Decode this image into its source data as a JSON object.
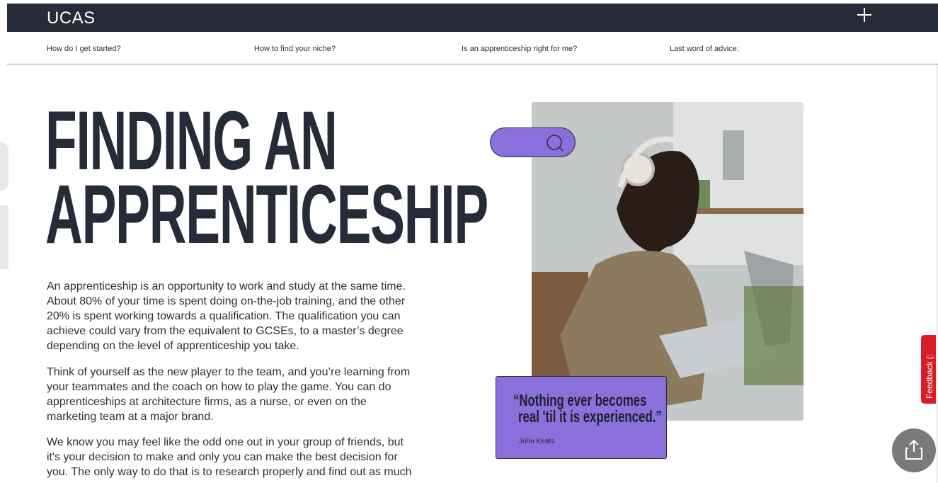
{
  "header": {
    "logo": "UCAS",
    "menu_icon": "plus-icon"
  },
  "subnav": {
    "items": [
      "How do I get started?",
      "How to find your niche?",
      "Is an apprenticeship right for me?",
      "Last word of advice:"
    ]
  },
  "hero": {
    "title_line1": "FINDING AN",
    "title_line2": "APPRENTICESHIP",
    "paragraphs": [
      "An apprenticeship is an opportunity to work and study at the same time. About 80% of your time is spent doing on-the-job training, and the other 20% is spent working towards a qualification. The qualification you can achieve could vary from the equivalent to GCSEs, to a master’s degree depending on the level of apprenticeship you take.",
      "Think of yourself as the new player to the team, and you’re learning from your teammates and the coach on how to play the game. You can do apprenticeships at architecture firms, as a nurse, or even on the marketing team at a major brand.",
      "We know you may feel like the odd one out in your group of friends, but it's your decision to make and  only you can make the best decision for you. The only way to do that is to research properly and find out as much"
    ]
  },
  "quote": {
    "line1": "“Nothing ever becomes",
    "line2": "real 'til it is experienced.”",
    "author": "John Keats"
  },
  "feedback": {
    "label": "Feedback (:"
  },
  "colors": {
    "header_bg": "#262b38",
    "accent_purple": "#8b70dc",
    "feedback_red": "#d91c2a",
    "text_dark": "#2c3038"
  },
  "icons": {
    "search": "search-icon",
    "share": "share-icon",
    "plus": "plus-icon"
  }
}
